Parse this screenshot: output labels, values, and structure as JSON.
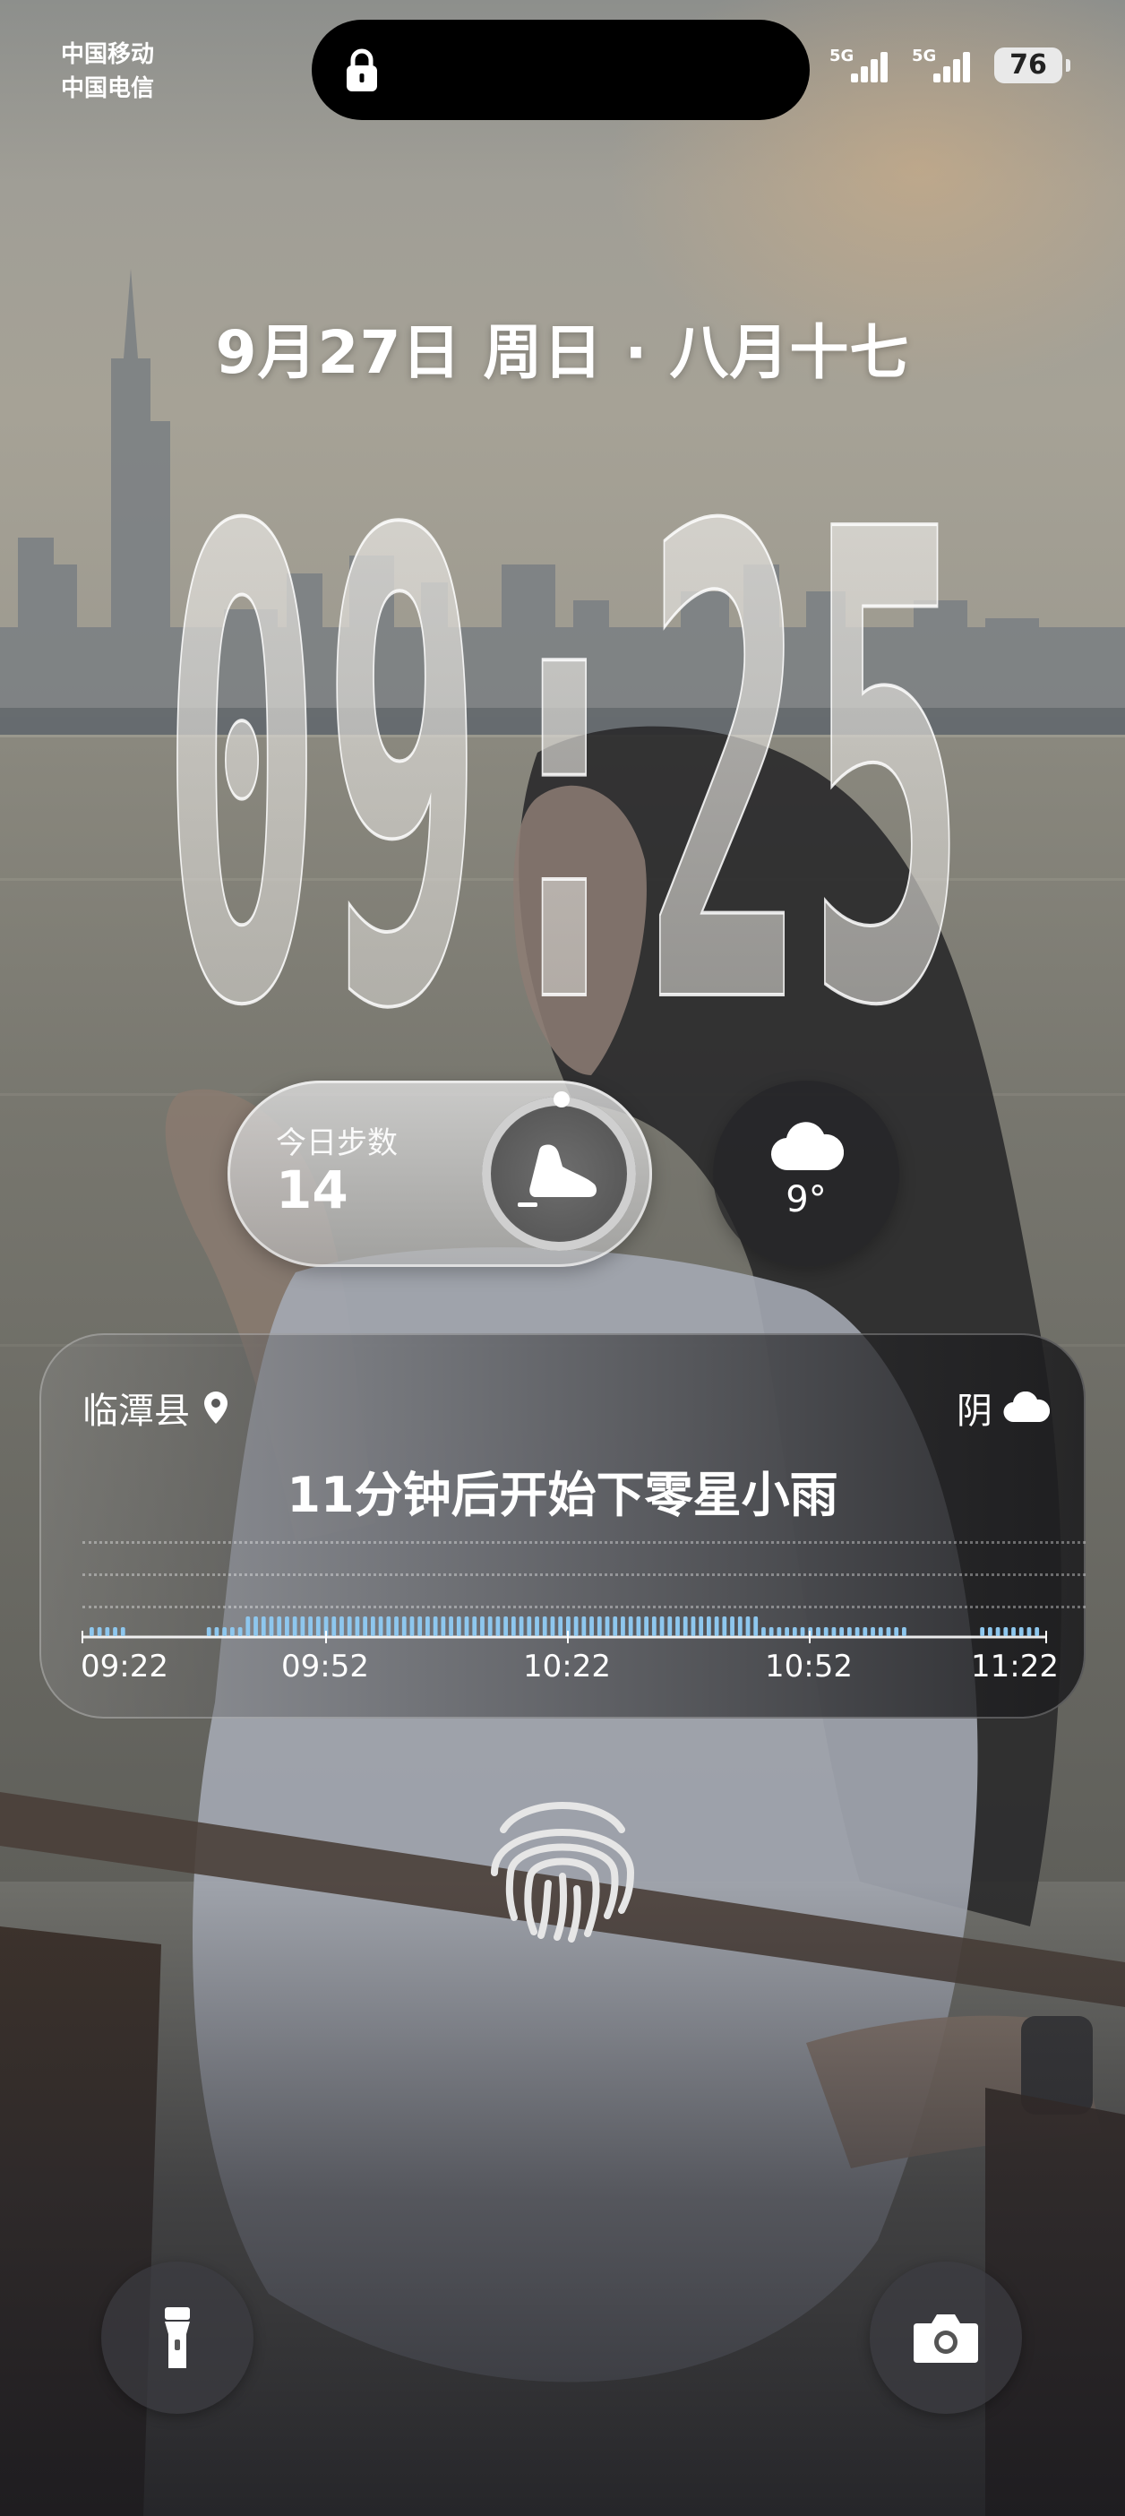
{
  "status_bar": {
    "carrier_1": "中国移动",
    "carrier_2": "中国电信",
    "signal_1_label": "5G",
    "signal_2_label": "5G",
    "battery": "76"
  },
  "lockscreen": {
    "date": "9月27日 周日 · 八月十七",
    "time": "09:25"
  },
  "steps_widget": {
    "label": "今日步数",
    "value": "14",
    "icon": "shoe-icon"
  },
  "weather_widget": {
    "temperature": "9°",
    "icon": "cloud-icon"
  },
  "rain_card": {
    "location": "临潭县",
    "condition": "阴",
    "forecast": "11分钟后开始下零星小雨",
    "ticks": [
      "09:22",
      "09:52",
      "10:22",
      "10:52",
      "11:22"
    ],
    "accent_color": "#8ec7ee",
    "precip_series": [
      1,
      1,
      1,
      1,
      1,
      0,
      0,
      0,
      0,
      0,
      0,
      0,
      0,
      0,
      0,
      1,
      1,
      1,
      1,
      1,
      2,
      2,
      2,
      2,
      2,
      2,
      2,
      2,
      2,
      2,
      2,
      2,
      2,
      2,
      2,
      2,
      2,
      2,
      2,
      2,
      2,
      2,
      2,
      2,
      2,
      2,
      2,
      2,
      2,
      2,
      2,
      2,
      2,
      2,
      2,
      2,
      2,
      2,
      2,
      2,
      2,
      2,
      2,
      2,
      2,
      2,
      2,
      2,
      2,
      2,
      2,
      2,
      2,
      2,
      2,
      2,
      2,
      2,
      2,
      2,
      2,
      2,
      2,
      2,
      2,
      2,
      1,
      1,
      1,
      1,
      1,
      1,
      1,
      1,
      1,
      1,
      1,
      1,
      1,
      1,
      1,
      1,
      1,
      1,
      1,
      0,
      0,
      0,
      0,
      0,
      0,
      0,
      0,
      0,
      1,
      1,
      1,
      1,
      1,
      1,
      1,
      1
    ]
  },
  "fingerprint": {
    "icon": "fingerprint-icon"
  },
  "shortcuts": {
    "left_icon": "flashlight-icon",
    "right_icon": "camera-icon"
  }
}
